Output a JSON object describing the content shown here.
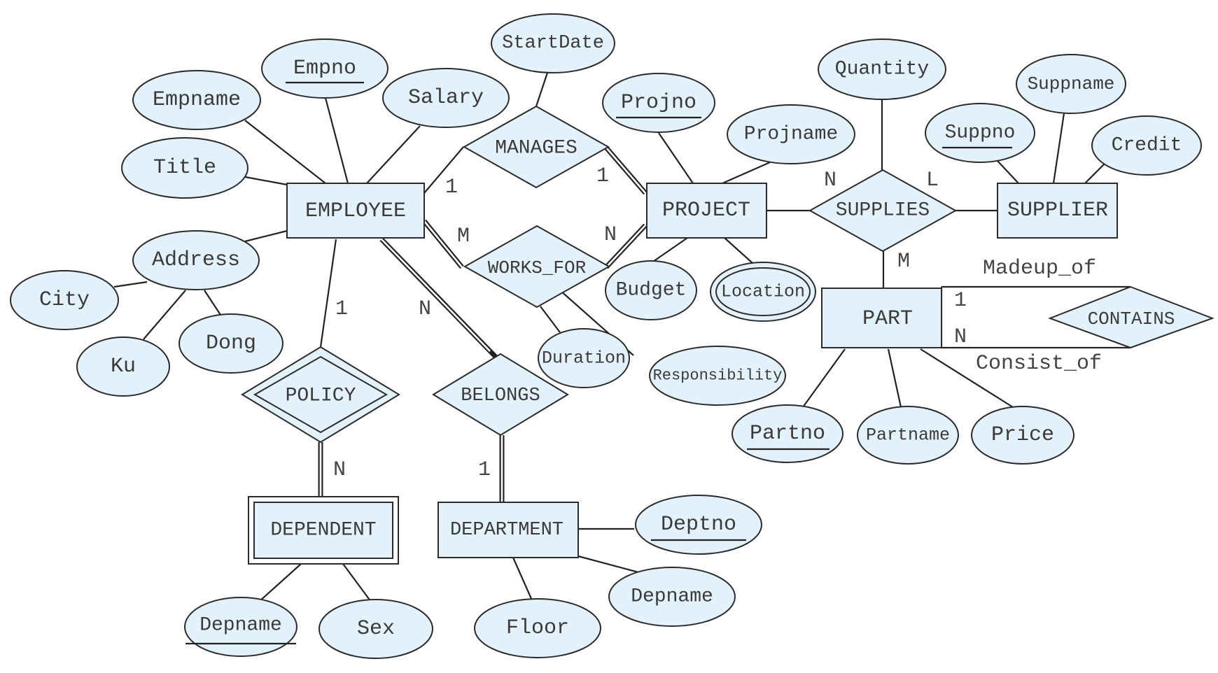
{
  "diagram": {
    "type": "er-diagram",
    "colors": {
      "fill": "#e3f1fb",
      "stroke": "#2b2b2b",
      "text": "#3a3a3a"
    },
    "entities": [
      {
        "id": "employee",
        "label": "EMPLOYEE",
        "weak": false
      },
      {
        "id": "project",
        "label": "PROJECT",
        "weak": false
      },
      {
        "id": "supplier",
        "label": "SUPPLIER",
        "weak": false
      },
      {
        "id": "part",
        "label": "PART",
        "weak": false
      },
      {
        "id": "dependent",
        "label": "DEPENDENT",
        "weak": true
      },
      {
        "id": "department",
        "label": "DEPARTMENT",
        "weak": false
      }
    ],
    "relationships": [
      {
        "id": "manages",
        "label": "MANAGES",
        "identifying": false
      },
      {
        "id": "works_for",
        "label": "WORKS_FOR",
        "identifying": false
      },
      {
        "id": "supplies",
        "label": "SUPPLIES",
        "identifying": false
      },
      {
        "id": "policy",
        "label": "POLICY",
        "identifying": true
      },
      {
        "id": "belongs",
        "label": "BELONGS",
        "identifying": false
      },
      {
        "id": "contains",
        "label": "CONTAINS",
        "identifying": false
      }
    ],
    "attributes": [
      {
        "id": "empno",
        "label": "Empno",
        "key": true,
        "owner": "employee"
      },
      {
        "id": "empname",
        "label": "Empname",
        "key": false,
        "owner": "employee"
      },
      {
        "id": "salary",
        "label": "Salary",
        "key": false,
        "owner": "employee"
      },
      {
        "id": "title",
        "label": "Title",
        "key": false,
        "owner": "employee"
      },
      {
        "id": "address",
        "label": "Address",
        "key": false,
        "owner": "employee",
        "composite": true
      },
      {
        "id": "city",
        "label": "City",
        "key": false,
        "owner": "address"
      },
      {
        "id": "ku",
        "label": "Ku",
        "key": false,
        "owner": "address"
      },
      {
        "id": "dong",
        "label": "Dong",
        "key": false,
        "owner": "address"
      },
      {
        "id": "startdate",
        "label": "StartDate",
        "key": false,
        "owner": "manages"
      },
      {
        "id": "projno",
        "label": "Projno",
        "key": true,
        "owner": "project"
      },
      {
        "id": "projname",
        "label": "Projname",
        "key": false,
        "owner": "project"
      },
      {
        "id": "budget",
        "label": "Budget",
        "key": false,
        "owner": "project"
      },
      {
        "id": "location",
        "label": "Location",
        "key": false,
        "owner": "project",
        "multivalued": true
      },
      {
        "id": "duration",
        "label": "Duration",
        "key": false,
        "owner": "works_for"
      },
      {
        "id": "responsibility",
        "label": "Responsibility",
        "key": false,
        "owner": "works_for"
      },
      {
        "id": "quantity",
        "label": "Quantity",
        "key": false,
        "owner": "supplies"
      },
      {
        "id": "suppno",
        "label": "Suppno",
        "key": true,
        "owner": "supplier"
      },
      {
        "id": "suppname",
        "label": "Suppname",
        "key": false,
        "owner": "supplier"
      },
      {
        "id": "credit",
        "label": "Credit",
        "key": false,
        "owner": "supplier"
      },
      {
        "id": "partno",
        "label": "Partno",
        "key": true,
        "owner": "part"
      },
      {
        "id": "partname",
        "label": "Partname",
        "key": false,
        "owner": "part"
      },
      {
        "id": "price",
        "label": "Price",
        "key": false,
        "owner": "part"
      },
      {
        "id": "depname_dependent",
        "label": "Depname",
        "key": true,
        "owner": "dependent"
      },
      {
        "id": "sex",
        "label": "Sex",
        "key": false,
        "owner": "dependent"
      },
      {
        "id": "deptno",
        "label": "Deptno",
        "key": true,
        "owner": "department"
      },
      {
        "id": "depname_department",
        "label": "Depname",
        "key": false,
        "owner": "department"
      },
      {
        "id": "floor",
        "label": "Floor",
        "key": false,
        "owner": "department"
      }
    ],
    "cardinalities": {
      "manages_employee": "1",
      "manages_project": "1",
      "works_for_employee": "M",
      "works_for_project": "N",
      "policy_employee": "1",
      "policy_dependent": "N",
      "belongs_employee": "N",
      "belongs_department": "1",
      "supplies_project": "N",
      "supplies_supplier": "L",
      "supplies_part": "M",
      "contains_madeup": "1",
      "contains_consist": "N"
    },
    "role_names": {
      "madeup_of": "Madeup_of",
      "consist_of": "Consist_of"
    }
  }
}
